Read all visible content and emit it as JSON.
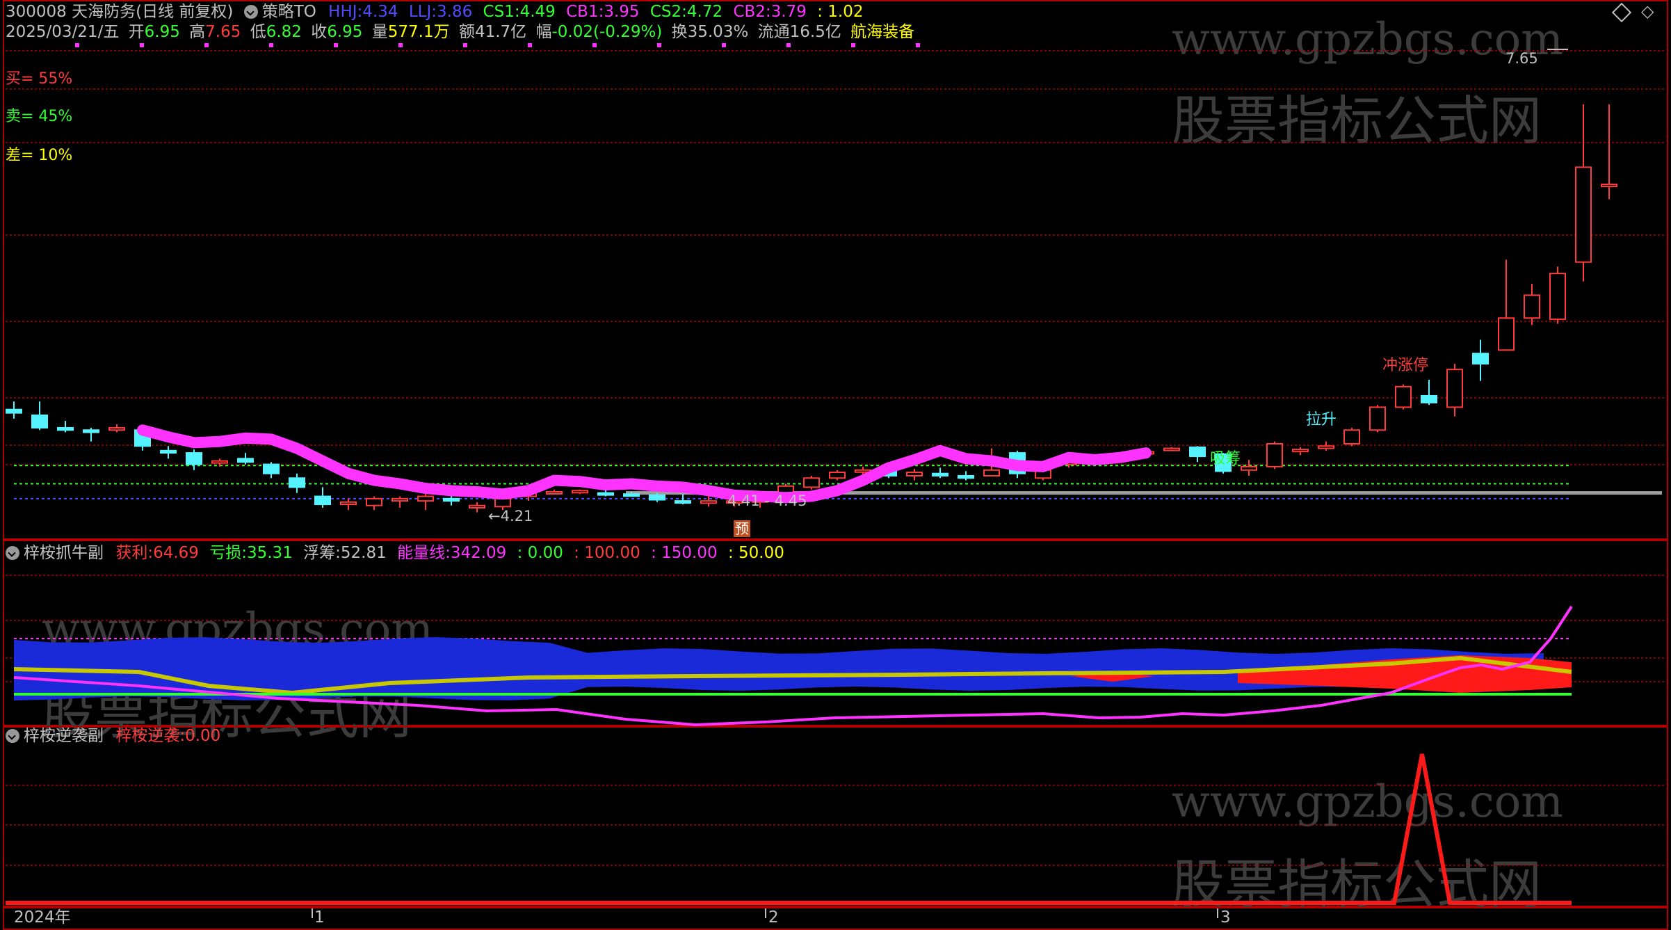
{
  "header": {
    "code_name": "300008 天海防务",
    "period": "(日线 前复权)",
    "strategy": "策略TO",
    "hhj_label": "HHJ:",
    "hhj_value": "4.34",
    "llj_label": "LLJ:",
    "llj_value": "3.86",
    "cs1_label": "CS1:",
    "cs1_value": "4.49",
    "cb1_label": "CB1:",
    "cb1_value": "3.95",
    "cs2_label": "CS2:",
    "cs2_value": "4.72",
    "cb2_label": "CB2:",
    "cb2_value": "3.79",
    "extra_value": ": 1.02",
    "date": "2025/03/21/五",
    "open_label": "开",
    "open_value": "6.95",
    "high_label": "高",
    "high_value": "7.65",
    "low_label": "低",
    "low_value": "6.82",
    "close_label": "收",
    "close_value": "6.95",
    "volume_label": "量",
    "volume_value": "577.1万",
    "amount_label": "额",
    "amount_value": "41.7亿",
    "change_label": "幅",
    "change_value": "-0.02(-0.29%)",
    "turnover_label": "换",
    "turnover_value": "35.03%",
    "float_label": "流通",
    "float_value": "16.5亿",
    "sector": "航海装备"
  },
  "left_stats": {
    "buy": "买= 55%",
    "sell": "卖= 45%",
    "diff": "差= 10%"
  },
  "price_annotations": {
    "high_mark": "7.65",
    "low_mark": "←4.21",
    "range_mark": "4.41 - 4.45",
    "pre_badge": "预",
    "label_chong": "冲涨停",
    "label_la": "拉升",
    "label_xi": "吸筹"
  },
  "indicator1": {
    "name": "梓桉抓牛副",
    "profit_label": "获利:",
    "profit_value": "64.69",
    "loss_label": "亏损:",
    "loss_value": "35.31",
    "float_label": "浮筹:",
    "float_value": "52.81",
    "energy_label": "能量线:",
    "energy_value": "342.09",
    "v0": ": 0.00",
    "v100": ": 100.00",
    "v150": ": 150.00",
    "v50": ": 50.00"
  },
  "indicator2": {
    "name": "梓桉逆袭副",
    "label": "梓桉逆袭:",
    "value": "0.00"
  },
  "xaxis": {
    "labels": [
      "2024年",
      "1",
      "2",
      "3"
    ]
  },
  "watermark": {
    "url": "www.gpzbgs.com",
    "cn": "股票指标公式网"
  },
  "colors": {
    "up": "#ff3b3b",
    "down": "#54f3ff",
    "magenta": "#ff33ff",
    "green": "#33ff33",
    "yellow": "#ffff00",
    "blue": "#4d4dff",
    "grid": "#b00000"
  },
  "chart_data": {
    "type": "candlestick",
    "candles": [
      {
        "o": 4.98,
        "h": 5.05,
        "l": 4.9,
        "c": 4.95
      },
      {
        "o": 4.93,
        "h": 5.05,
        "l": 4.8,
        "c": 4.82
      },
      {
        "o": 4.82,
        "h": 4.88,
        "l": 4.78,
        "c": 4.8
      },
      {
        "o": 4.8,
        "h": 4.82,
        "l": 4.7,
        "c": 4.78
      },
      {
        "o": 4.8,
        "h": 4.85,
        "l": 4.78,
        "c": 4.82
      },
      {
        "o": 4.8,
        "h": 4.82,
        "l": 4.62,
        "c": 4.66
      },
      {
        "o": 4.62,
        "h": 4.66,
        "l": 4.55,
        "c": 4.6
      },
      {
        "o": 4.6,
        "h": 4.63,
        "l": 4.45,
        "c": 4.5
      },
      {
        "o": 4.52,
        "h": 4.55,
        "l": 4.48,
        "c": 4.53
      },
      {
        "o": 4.55,
        "h": 4.6,
        "l": 4.5,
        "c": 4.52
      },
      {
        "o": 4.5,
        "h": 4.52,
        "l": 4.38,
        "c": 4.42
      },
      {
        "o": 4.38,
        "h": 4.42,
        "l": 4.25,
        "c": 4.3
      },
      {
        "o": 4.22,
        "h": 4.3,
        "l": 4.12,
        "c": 4.15
      },
      {
        "o": 4.15,
        "h": 4.2,
        "l": 4.1,
        "c": 4.17
      },
      {
        "o": 4.14,
        "h": 4.22,
        "l": 4.1,
        "c": 4.2
      },
      {
        "o": 4.18,
        "h": 4.22,
        "l": 4.12,
        "c": 4.2
      },
      {
        "o": 4.18,
        "h": 4.24,
        "l": 4.1,
        "c": 4.22
      },
      {
        "o": 4.2,
        "h": 4.24,
        "l": 4.14,
        "c": 4.18
      },
      {
        "o": 4.12,
        "h": 4.17,
        "l": 4.08,
        "c": 4.14
      },
      {
        "o": 4.13,
        "h": 4.21,
        "l": 4.1,
        "c": 4.2
      },
      {
        "o": 4.22,
        "h": 4.28,
        "l": 4.18,
        "c": 4.27
      },
      {
        "o": 4.26,
        "h": 4.28,
        "l": 4.24,
        "c": 4.26
      },
      {
        "o": 4.26,
        "h": 4.28,
        "l": 4.24,
        "c": 4.27
      },
      {
        "o": 4.25,
        "h": 4.3,
        "l": 4.22,
        "c": 4.24
      },
      {
        "o": 4.24,
        "h": 4.26,
        "l": 4.22,
        "c": 4.23
      },
      {
        "o": 4.23,
        "h": 4.25,
        "l": 4.17,
        "c": 4.19
      },
      {
        "o": 4.18,
        "h": 4.24,
        "l": 4.15,
        "c": 4.17
      },
      {
        "o": 4.16,
        "h": 4.22,
        "l": 4.13,
        "c": 4.18
      },
      {
        "o": 4.17,
        "h": 4.2,
        "l": 4.13,
        "c": 4.18
      },
      {
        "o": 4.17,
        "h": 4.26,
        "l": 4.12,
        "c": 4.23
      },
      {
        "o": 4.25,
        "h": 4.33,
        "l": 4.24,
        "c": 4.31
      },
      {
        "o": 4.3,
        "h": 4.4,
        "l": 4.28,
        "c": 4.38
      },
      {
        "o": 4.38,
        "h": 4.45,
        "l": 4.36,
        "c": 4.43
      },
      {
        "o": 4.44,
        "h": 4.48,
        "l": 4.4,
        "c": 4.45
      },
      {
        "o": 4.45,
        "h": 4.48,
        "l": 4.38,
        "c": 4.4
      },
      {
        "o": 4.4,
        "h": 4.46,
        "l": 4.36,
        "c": 4.43
      },
      {
        "o": 4.42,
        "h": 4.47,
        "l": 4.38,
        "c": 4.4
      },
      {
        "o": 4.4,
        "h": 4.44,
        "l": 4.36,
        "c": 4.38
      },
      {
        "o": 4.4,
        "h": 4.64,
        "l": 4.4,
        "c": 4.45
      },
      {
        "o": 4.6,
        "h": 4.62,
        "l": 4.38,
        "c": 4.42
      },
      {
        "o": 4.38,
        "h": 4.48,
        "l": 4.36,
        "c": 4.45
      },
      {
        "o": 4.5,
        "h": 4.55,
        "l": 4.47,
        "c": 4.52
      },
      {
        "o": 4.54,
        "h": 4.58,
        "l": 4.5,
        "c": 4.57
      },
      {
        "o": 4.58,
        "h": 4.61,
        "l": 4.55,
        "c": 4.59
      },
      {
        "o": 4.6,
        "h": 4.63,
        "l": 4.55,
        "c": 4.61
      },
      {
        "o": 4.64,
        "h": 4.65,
        "l": 4.62,
        "c": 4.64
      },
      {
        "o": 4.65,
        "h": 4.66,
        "l": 4.52,
        "c": 4.57
      },
      {
        "o": 4.59,
        "h": 4.6,
        "l": 4.42,
        "c": 4.44
      },
      {
        "o": 4.45,
        "h": 4.54,
        "l": 4.4,
        "c": 4.48
      },
      {
        "o": 4.48,
        "h": 4.7,
        "l": 4.46,
        "c": 4.68
      },
      {
        "o": 4.62,
        "h": 4.65,
        "l": 4.58,
        "c": 4.63
      },
      {
        "o": 4.64,
        "h": 4.7,
        "l": 4.62,
        "c": 4.66
      },
      {
        "o": 4.68,
        "h": 4.82,
        "l": 4.66,
        "c": 4.8
      },
      {
        "o": 4.8,
        "h": 5.02,
        "l": 4.78,
        "c": 5.0
      },
      {
        "o": 5.0,
        "h": 5.2,
        "l": 4.98,
        "c": 5.18
      },
      {
        "o": 5.1,
        "h": 5.24,
        "l": 5.02,
        "c": 5.04
      },
      {
        "o": 5.0,
        "h": 5.38,
        "l": 4.92,
        "c": 5.33
      },
      {
        "o": 5.47,
        "h": 5.59,
        "l": 5.23,
        "c": 5.38
      },
      {
        "o": 5.5,
        "h": 6.29,
        "l": 5.52,
        "c": 5.78
      },
      {
        "o": 5.78,
        "h": 6.08,
        "l": 5.72,
        "c": 5.98
      },
      {
        "o": 5.77,
        "h": 6.23,
        "l": 5.73,
        "c": 6.17
      },
      {
        "o": 6.27,
        "h": 7.65,
        "l": 6.1,
        "c": 7.1
      },
      {
        "o": 6.95,
        "h": 7.65,
        "l": 6.82,
        "c": 6.95
      }
    ],
    "ma_line": [
      4.8,
      4.74,
      4.69,
      4.7,
      4.73,
      4.72,
      4.64,
      4.53,
      4.42,
      4.36,
      4.33,
      4.29,
      4.27,
      4.26,
      4.24,
      4.27,
      4.36,
      4.35,
      4.32,
      4.33,
      4.31,
      4.3,
      4.27,
      4.23,
      4.22,
      4.21,
      4.22,
      4.27,
      4.36,
      4.47,
      4.54,
      4.62,
      4.55,
      4.53,
      4.49,
      4.48,
      4.56,
      4.54,
      4.56,
      4.6
    ],
    "levels": {
      "upper_green": 4.49,
      "mid_green": 4.33,
      "lower_blue": 4.2,
      "gray": 4.25
    }
  }
}
